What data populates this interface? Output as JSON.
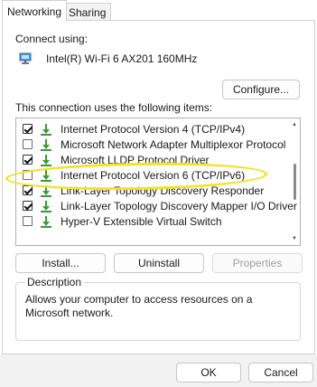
{
  "tabs": [
    {
      "label": "Networking"
    },
    {
      "label": "Sharing"
    }
  ],
  "connect_using_label": "Connect using:",
  "adapter_name": "Intel(R) Wi-Fi 6 AX201 160MHz",
  "configure_label": "Configure...",
  "items_label": "This connection uses the following items:",
  "items": [
    {
      "label": "Internet Protocol Version 4 (TCP/IPv4)",
      "checked": true
    },
    {
      "label": "Microsoft Network Adapter Multiplexor Protocol",
      "checked": false
    },
    {
      "label": "Microsoft LLDP Protocol Driver",
      "checked": true
    },
    {
      "label": "Internet Protocol Version 6 (TCP/IPv6)",
      "checked": false
    },
    {
      "label": "Link-Layer Topology Discovery Responder",
      "checked": true
    },
    {
      "label": "Link-Layer Topology Discovery Mapper I/O Driver",
      "checked": true
    },
    {
      "label": "Hyper-V Extensible Virtual Switch",
      "checked": false
    }
  ],
  "buttons": {
    "install": "Install...",
    "uninstall": "Uninstall",
    "properties": "Properties",
    "ok": "OK",
    "cancel": "Cancel"
  },
  "description": {
    "title": "Description",
    "text": "Allows your computer to access resources on a Microsoft network."
  },
  "colors": {
    "highlight": "#f3e32b",
    "accent": "#1f6fb2"
  }
}
